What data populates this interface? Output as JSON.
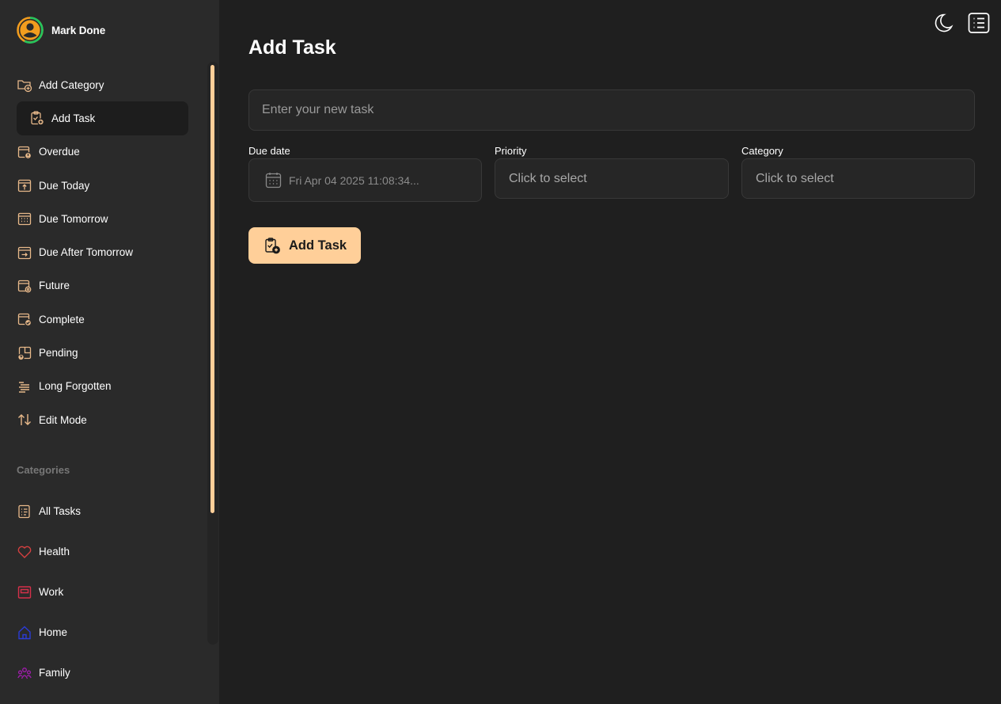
{
  "brand": {
    "name": "Mark Done",
    "logo_icon": "user-circle-logo-icon"
  },
  "sidebar": {
    "items": [
      {
        "label": "Add Category",
        "icon": "folder-plus-icon",
        "active": false
      },
      {
        "label": "Add Task",
        "icon": "clipboard-plus-icon",
        "active": true
      },
      {
        "label": "Overdue",
        "icon": "calendar-alert-icon",
        "active": false
      },
      {
        "label": "Due Today",
        "icon": "calendar-upload-icon",
        "active": false
      },
      {
        "label": "Due Tomorrow",
        "icon": "calendar-grid-icon",
        "active": false
      },
      {
        "label": "Due After Tomorrow",
        "icon": "calendar-arrow-right-icon",
        "active": false
      },
      {
        "label": "Future",
        "icon": "calendar-gear-icon",
        "active": false
      },
      {
        "label": "Complete",
        "icon": "calendar-check-icon",
        "active": false
      },
      {
        "label": "Pending",
        "icon": "calendar-question-icon",
        "active": false
      },
      {
        "label": "Long Forgotten",
        "icon": "list-lines-icon",
        "active": false
      },
      {
        "label": "Edit Mode",
        "icon": "sort-arrows-icon",
        "active": false
      }
    ],
    "categories_heading": "Categories",
    "categories": [
      {
        "label": "All Tasks",
        "icon": "task-list-icon",
        "color": "#e8b98a"
      },
      {
        "label": "Health",
        "icon": "heart-icon",
        "color": "#d64040"
      },
      {
        "label": "Work",
        "icon": "briefcase-icon",
        "color": "#d6304a"
      },
      {
        "label": "Home",
        "icon": "home-icon",
        "color": "#2b3bd6"
      },
      {
        "label": "Family",
        "icon": "family-icon",
        "color": "#a21caf"
      }
    ]
  },
  "header": {
    "theme_toggle_icon": "moon-icon",
    "menu_icon": "list-menu-icon"
  },
  "main": {
    "title": "Add Task",
    "task_input": {
      "placeholder": "Enter your new task",
      "value": ""
    },
    "due_date": {
      "label": "Due date",
      "value": "Fri Apr 04 2025 11:08:34...",
      "icon": "calendar-icon"
    },
    "priority": {
      "label": "Priority",
      "value": "Click to select"
    },
    "category": {
      "label": "Category",
      "value": "Click to select"
    },
    "submit": {
      "label": "Add Task",
      "icon": "clipboard-plus-icon"
    }
  },
  "colors": {
    "accent": "#ffcf99",
    "sidebar_bg": "#2a2a2a",
    "main_bg": "#1f1f1f",
    "field_bg": "#262626"
  }
}
